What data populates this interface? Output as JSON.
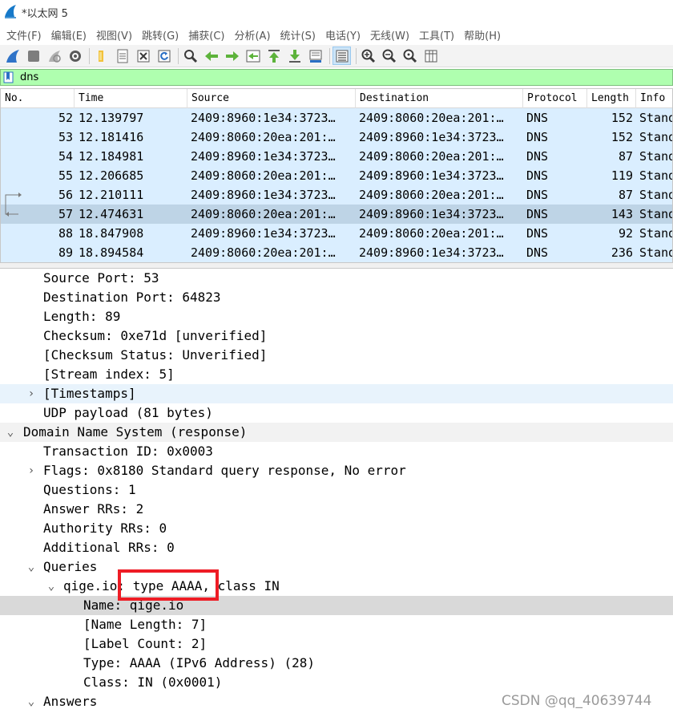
{
  "window": {
    "title": "*以太网 5"
  },
  "menu": [
    {
      "label": "文件(F)"
    },
    {
      "label": "编辑(E)"
    },
    {
      "label": "视图(V)"
    },
    {
      "label": "跳转(G)"
    },
    {
      "label": "捕获(C)"
    },
    {
      "label": "分析(A)"
    },
    {
      "label": "统计(S)"
    },
    {
      "label": "电话(Y)"
    },
    {
      "label": "无线(W)"
    },
    {
      "label": "工具(T)"
    },
    {
      "label": "帮助(H)"
    }
  ],
  "toolbar": {
    "icons": [
      "shark-fin-icon",
      "stop-square-icon",
      "restart-fin-icon",
      "gear-icon",
      "folder-icon",
      "file-icon",
      "close-file-icon",
      "reload-icon",
      "find-icon",
      "go-back-icon",
      "go-forward-icon",
      "go-to-packet-icon",
      "first-packet-icon",
      "last-packet-icon",
      "autoscroll-icon",
      "colorize-icon",
      "zoom-in-icon",
      "zoom-out-icon",
      "zoom-normal-icon",
      "resize-columns-icon"
    ]
  },
  "filter": {
    "value": "dns"
  },
  "packet_list": {
    "columns": [
      "No.",
      "Time",
      "Source",
      "Destination",
      "Protocol",
      "Length",
      "Info"
    ],
    "rows": [
      {
        "no": "52",
        "time": "12.139797",
        "src": "2409:8960:1e34:3723…",
        "dst": "2409:8060:20ea:201:…",
        "proto": "DNS",
        "len": "152",
        "info": "Stand"
      },
      {
        "no": "53",
        "time": "12.181416",
        "src": "2409:8060:20ea:201:…",
        "dst": "2409:8960:1e34:3723…",
        "proto": "DNS",
        "len": "152",
        "info": "Stand"
      },
      {
        "no": "54",
        "time": "12.184981",
        "src": "2409:8960:1e34:3723…",
        "dst": "2409:8060:20ea:201:…",
        "proto": "DNS",
        "len": "87",
        "info": "Stand"
      },
      {
        "no": "55",
        "time": "12.206685",
        "src": "2409:8060:20ea:201:…",
        "dst": "2409:8960:1e34:3723…",
        "proto": "DNS",
        "len": "119",
        "info": "Stand"
      },
      {
        "no": "56",
        "time": "12.210111",
        "src": "2409:8960:1e34:3723…",
        "dst": "2409:8060:20ea:201:…",
        "proto": "DNS",
        "len": "87",
        "info": "Stand"
      },
      {
        "no": "57",
        "time": "12.474631",
        "src": "2409:8060:20ea:201:…",
        "dst": "2409:8960:1e34:3723…",
        "proto": "DNS",
        "len": "143",
        "info": "Stand"
      },
      {
        "no": "88",
        "time": "18.847908",
        "src": "2409:8960:1e34:3723…",
        "dst": "2409:8060:20ea:201:…",
        "proto": "DNS",
        "len": "92",
        "info": "Stand"
      },
      {
        "no": "89",
        "time": "18.894584",
        "src": "2409:8060:20ea:201:…",
        "dst": "2409:8960:1e34:3723…",
        "proto": "DNS",
        "len": "236",
        "info": "Stand"
      }
    ]
  },
  "details": [
    {
      "text": "Source Port: 53"
    },
    {
      "text": "Destination Port: 64823"
    },
    {
      "text": "Length: 89"
    },
    {
      "text": "Checksum: 0xe71d [unverified]"
    },
    {
      "text": "[Checksum Status: Unverified]"
    },
    {
      "text": "[Stream index: 5]"
    },
    {
      "text": "[Timestamps]"
    },
    {
      "text": "UDP payload (81 bytes)"
    },
    {
      "text": "Domain Name System (response)"
    },
    {
      "text": "Transaction ID: 0x0003"
    },
    {
      "text": "Flags: 0x8180 Standard query response, No error"
    },
    {
      "text": "Questions: 1"
    },
    {
      "text": "Answer RRs: 2"
    },
    {
      "text": "Authority RRs: 0"
    },
    {
      "text": "Additional RRs: 0"
    },
    {
      "text": "Queries"
    },
    {
      "text": "qige.io: type AAAA, class IN"
    },
    {
      "text": "Name: qige.io"
    },
    {
      "text": "[Name Length: 7]"
    },
    {
      "text": "[Label Count: 2]"
    },
    {
      "text": "Type: AAAA (IPv6 Address) (28)"
    },
    {
      "text": "Class: IN (0x0001)"
    },
    {
      "text": "Answers"
    }
  ],
  "watermark": "CSDN @qq_40639744",
  "colors": {
    "row_bg": "#daeeff",
    "row_selected": "#bed4e6",
    "filter_ok": "#afffaf",
    "detail_selected": "#d9d9d9",
    "annotation": "#ee1c25"
  }
}
